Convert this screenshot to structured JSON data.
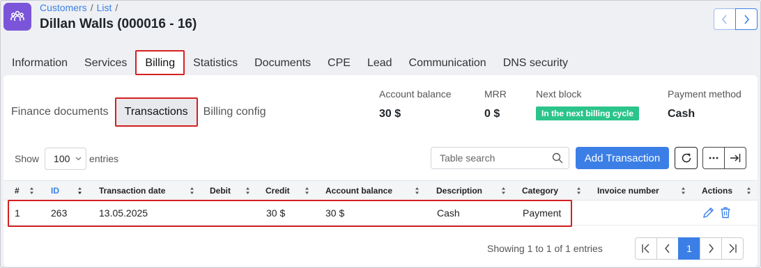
{
  "header": {
    "breadcrumb": [
      "Customers",
      "List"
    ],
    "title": "Dillan Walls (000016 - 16)",
    "app_icon": "users-group-icon"
  },
  "tabs": [
    {
      "label": "Information",
      "active": false
    },
    {
      "label": "Services",
      "active": false
    },
    {
      "label": "Billing",
      "active": true
    },
    {
      "label": "Statistics",
      "active": false
    },
    {
      "label": "Documents",
      "active": false
    },
    {
      "label": "CPE",
      "active": false
    },
    {
      "label": "Lead",
      "active": false
    },
    {
      "label": "Communication",
      "active": false
    },
    {
      "label": "DNS security",
      "active": false
    }
  ],
  "subtabs": [
    {
      "label": "Finance documents",
      "active": false
    },
    {
      "label": "Transactions",
      "active": true
    },
    {
      "label": "Billing config",
      "active": false
    }
  ],
  "summary": {
    "account_balance": {
      "label": "Account balance",
      "value": "30 $"
    },
    "mrr": {
      "label": "MRR",
      "value": "0 $"
    },
    "next_block": {
      "label": "Next block",
      "value": "In the next billing cycle"
    },
    "payment_method": {
      "label": "Payment method",
      "value": "Cash"
    }
  },
  "toolbar": {
    "show_label": "Show",
    "entries_value": "100",
    "entries_label": "entries",
    "search_placeholder": "Table search",
    "add_label": "Add Transaction"
  },
  "table": {
    "columns": [
      "#",
      "ID",
      "Transaction date",
      "Debit",
      "Credit",
      "Account balance",
      "Description",
      "Category",
      "Invoice number",
      "Actions"
    ],
    "sorted_column": "ID",
    "rows": [
      {
        "num": "1",
        "id": "263",
        "date": "13.05.2025",
        "debit": "",
        "credit": "30 $",
        "balance": "30 $",
        "description": "Cash",
        "category": "Payment",
        "invoice": ""
      }
    ]
  },
  "footer": {
    "info": "Showing 1 to 1 of 1 entries",
    "current_page": "1"
  },
  "colors": {
    "accent": "#3b7fe6",
    "app_icon": "#7b55d9",
    "badge": "#2bc48a",
    "highlight": "#d42020"
  }
}
